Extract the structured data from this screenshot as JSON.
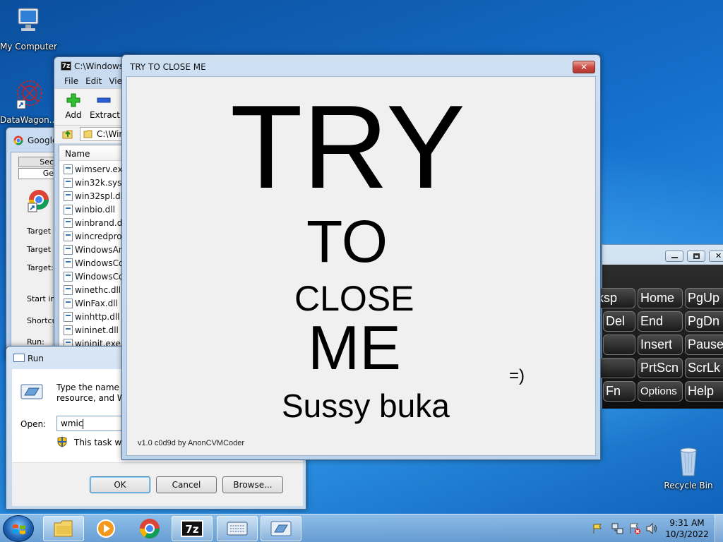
{
  "desktop": {
    "icons": [
      {
        "label": "My Computer"
      },
      {
        "label": "DataWagon..."
      },
      {
        "label": "Recycle Bin"
      }
    ]
  },
  "chrome_props": {
    "title": "Google",
    "tabs": [
      "Secu",
      "Gen"
    ],
    "fields": [
      "Target ty",
      "Target lo",
      "Target:",
      "Start in:",
      "Shortcut",
      "Run:"
    ]
  },
  "sevenzip": {
    "title": "C:\\Windows\\",
    "menu": [
      "File",
      "Edit",
      "Vie"
    ],
    "toolbar": {
      "add": "Add",
      "extract": "Extract"
    },
    "path": "C:\\Win",
    "column_name": "Name",
    "files": [
      "wimserv.exe",
      "win32k.sys",
      "win32spl.dll",
      "winbio.dll",
      "winbrand.dll",
      "wincredprov",
      "WindowsAn",
      "WindowsCo",
      "WindowsCo",
      "winethc.dll",
      "WinFax.dll",
      "winhttp.dll",
      "wininet.dll",
      "wininit.exe"
    ]
  },
  "run_dialog": {
    "title": "Run",
    "description_line1": "Type the name of",
    "description_line2": "resource, and Win",
    "open_label": "Open:",
    "open_value": "wmic",
    "admin_note": "This task will",
    "ok": "OK",
    "cancel": "Cancel",
    "browse": "Browse..."
  },
  "try_window": {
    "title": "TRY TO CLOSE ME",
    "line1": "TRY",
    "line2": "TO",
    "line3": "CLOSE",
    "line4": "ME",
    "smiley": "=)",
    "sub": "Sussy buka",
    "footer": "v1.0 c0d9d by AnonCVMCoder"
  },
  "osk": {
    "keys": [
      "ksp",
      "Home",
      "PgUp",
      "Del",
      "End",
      "PgDn",
      "",
      "Insert",
      "Pause",
      "t",
      "PrtScn",
      "ScrLk",
      "Fn",
      "Options",
      "Help"
    ]
  },
  "taskbar": {
    "time": "9:31 AM",
    "date": "10/3/2022"
  },
  "colors": {
    "accent": "#1672cf",
    "close_red": "#c9463d"
  }
}
